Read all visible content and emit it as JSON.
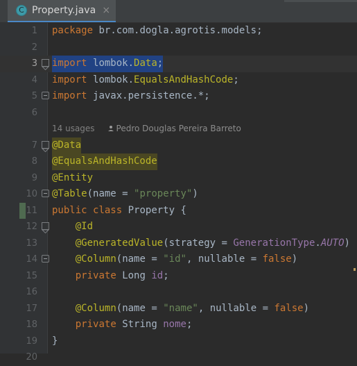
{
  "window": {
    "background": "#2b2b2b",
    "gutter_background": "#313335"
  },
  "tabbar": {
    "background": "#3c3f41",
    "active_tab": {
      "label": "Property.java",
      "icon": "java-class-icon",
      "icon_glyph": "C",
      "icon_color": "#3d9aa8",
      "close_glyph": "×",
      "active_underline_color": "#4a88c7"
    }
  },
  "editor": {
    "current_line": 3,
    "changed_lines": [
      11
    ],
    "colors": {
      "keyword": "#cc7832",
      "annotation": "#bbb529",
      "string": "#6a8759",
      "field": "#9876aa",
      "default_text": "#a9b7c6",
      "line_number": "#606366",
      "current_line_number": "#a4a3a3",
      "selection": "#214283",
      "current_line_bg": "#323232",
      "change_marker": "#4f6a50",
      "inlay_hint": "#808080"
    },
    "inlay_hint": {
      "usages": "14 usages",
      "author": "Pedro Douglas Pereira Barreto",
      "author_icon": "person-icon"
    },
    "line_numbers": [
      1,
      2,
      3,
      4,
      5,
      6,
      7,
      8,
      9,
      10,
      11,
      12,
      13,
      14,
      15,
      16,
      17,
      18,
      19,
      20
    ],
    "lines": [
      {
        "n": 1,
        "text": "package br.com.dogla.agrotis.models;"
      },
      {
        "n": 2,
        "text": ""
      },
      {
        "n": 3,
        "text": "import lombok.Data;",
        "selected": true,
        "fold": "collapse-arrow"
      },
      {
        "n": 4,
        "text": "import lombok.EqualsAndHashCode;"
      },
      {
        "n": 5,
        "text": "import javax.persistence.*;",
        "fold": "collapse"
      },
      {
        "n": 6,
        "text": ""
      },
      {
        "n": 7,
        "text": "@Data",
        "highlighted": true,
        "fold": "collapse-arrow"
      },
      {
        "n": 8,
        "text": "@EqualsAndHashCode",
        "highlighted": true
      },
      {
        "n": 9,
        "text": "@Entity"
      },
      {
        "n": 10,
        "text": "@Table(name = \"property\")",
        "fold": "collapse"
      },
      {
        "n": 11,
        "text": "public class Property {",
        "changed": true
      },
      {
        "n": 12,
        "text": "    @Id",
        "fold": "collapse-arrow"
      },
      {
        "n": 13,
        "text": "    @GeneratedValue(strategy = GenerationType.AUTO)"
      },
      {
        "n": 14,
        "text": "    @Column(name = \"id\", nullable = false)",
        "fold": "collapse"
      },
      {
        "n": 15,
        "text": "    private Long id;"
      },
      {
        "n": 16,
        "text": ""
      },
      {
        "n": 17,
        "text": "    @Column(name = \"name\", nullable = false)"
      },
      {
        "n": 18,
        "text": "    private String nome;"
      },
      {
        "n": 19,
        "text": "}"
      },
      {
        "n": 20,
        "text": ""
      }
    ]
  }
}
